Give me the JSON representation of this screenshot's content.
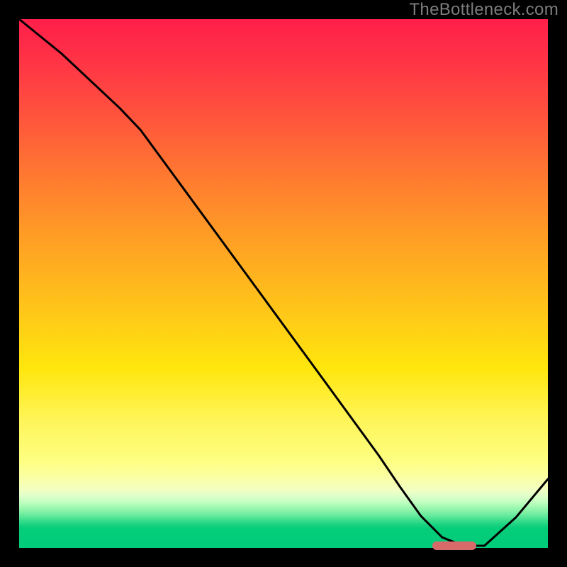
{
  "watermark": "TheBottleneck.com",
  "chart_data": {
    "type": "line",
    "title": "",
    "xlabel": "",
    "ylabel": "",
    "xlim": [
      0,
      100
    ],
    "ylim": [
      0,
      100
    ],
    "grid": false,
    "legend": false,
    "series": [
      {
        "name": "bottleneck-curve",
        "x": [
          0,
          8,
          19,
          23,
          34,
          46,
          58,
          68,
          72,
          76,
          80,
          84,
          88,
          94,
          100
        ],
        "values": [
          100,
          93.5,
          83.2,
          79,
          64,
          47.6,
          31.2,
          17.5,
          11.6,
          6,
          2,
          0.4,
          0.4,
          5.8,
          13
        ]
      }
    ],
    "marker": {
      "name": "optimal-range",
      "x_start": 78.2,
      "x_end": 86.4,
      "y": 0.4
    },
    "gradient_stops": [
      {
        "pct": 0,
        "color": "#ff1f4a"
      },
      {
        "pct": 50,
        "color": "#ffcf14"
      },
      {
        "pct": 84,
        "color": "#fdff82"
      },
      {
        "pct": 96,
        "color": "#00cc79"
      },
      {
        "pct": 100,
        "color": "#00cc79"
      }
    ]
  }
}
